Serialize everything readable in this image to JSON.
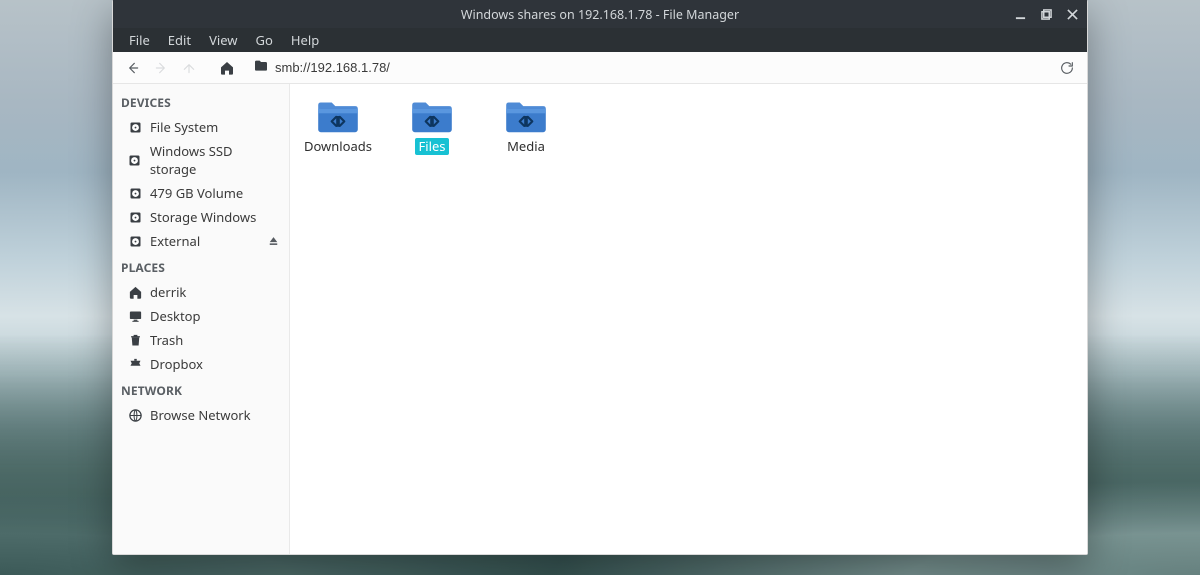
{
  "window": {
    "title": "Windows shares on 192.168.1.78 - File Manager"
  },
  "menu": {
    "file": "File",
    "edit": "Edit",
    "view": "View",
    "go": "Go",
    "help": "Help"
  },
  "location": {
    "path": "smb://192.168.1.78/"
  },
  "sidebar": {
    "devices": {
      "title": "DEVICES",
      "items": [
        {
          "label": "File System",
          "icon": "disk-icon"
        },
        {
          "label": "Windows SSD storage",
          "icon": "disk-icon"
        },
        {
          "label": "479 GB Volume",
          "icon": "disk-icon"
        },
        {
          "label": "Storage Windows",
          "icon": "disk-icon"
        },
        {
          "label": "External",
          "icon": "disk-icon",
          "ejectable": true
        }
      ]
    },
    "places": {
      "title": "PLACES",
      "items": [
        {
          "label": "derrik",
          "icon": "home-icon"
        },
        {
          "label": "Desktop",
          "icon": "desktop-icon"
        },
        {
          "label": "Trash",
          "icon": "trash-icon"
        },
        {
          "label": "Dropbox",
          "icon": "dropbox-icon"
        }
      ]
    },
    "network": {
      "title": "NETWORK",
      "items": [
        {
          "label": "Browse Network",
          "icon": "globe-icon"
        }
      ]
    }
  },
  "contents": {
    "items": [
      {
        "label": "Downloads",
        "selected": false
      },
      {
        "label": "Files",
        "selected": true
      },
      {
        "label": "Media",
        "selected": false
      }
    ]
  }
}
